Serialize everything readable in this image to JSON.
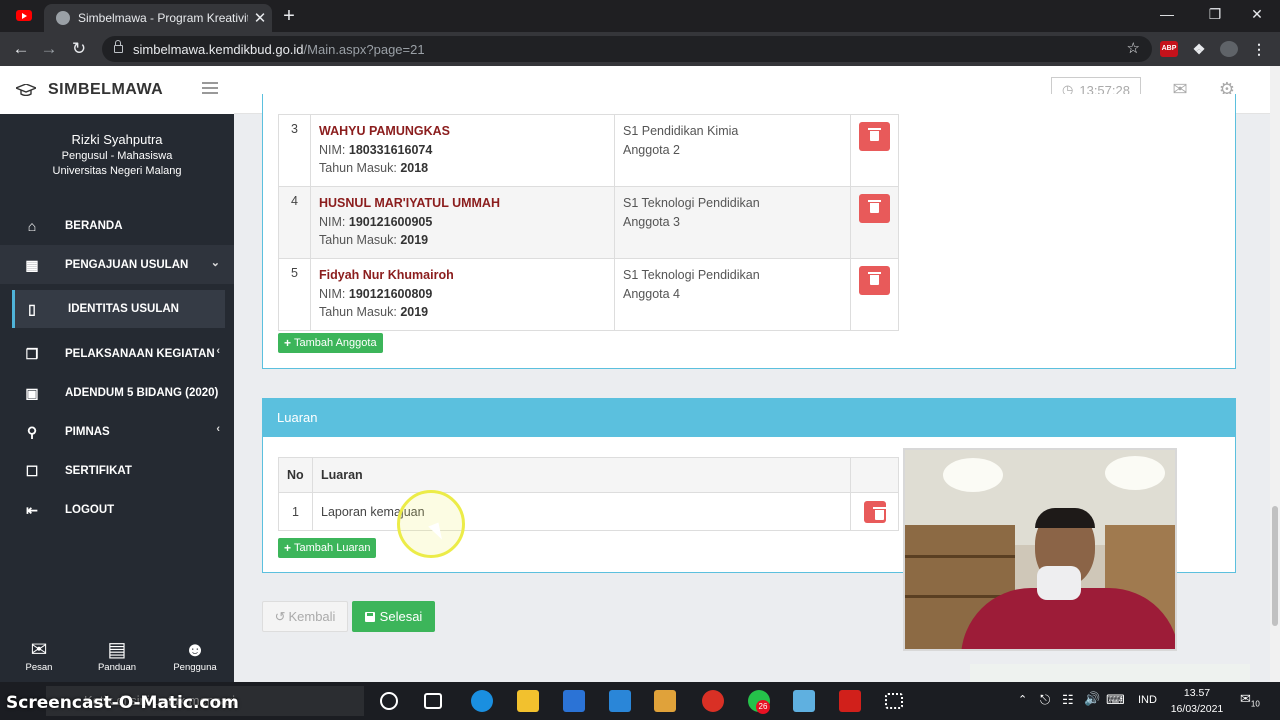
{
  "browser": {
    "tab_title": "Simbelmawa - Program Kreativita",
    "tab_close": "✕",
    "new_tab": "+",
    "url_host": "simbelmawa.kemdikbud.go.id",
    "url_path": "/Main.aspx?page=21",
    "ext_abp": "ABP"
  },
  "sidebar": {
    "brand": "SIMBELMAWA",
    "user_name": "Rizki Syahputra",
    "user_role": "Pengusul - Mahasiswa",
    "user_univ": "Universitas Negeri Malang",
    "menu": [
      {
        "label": "BERANDA",
        "icon": "home-icon"
      },
      {
        "label": "PENGAJUAN USULAN",
        "icon": "book-open-icon"
      },
      {
        "label": "IDENTITAS USULAN",
        "icon": "book-icon"
      },
      {
        "label": "PELAKSANAAN KEGIATAN",
        "icon": "copy-icon"
      },
      {
        "label": "ADENDUM 5 BIDANG (2020)",
        "icon": "briefcase-icon"
      },
      {
        "label": "PIMNAS",
        "icon": "trophy-icon"
      },
      {
        "label": "SERTIFIKAT",
        "icon": "file-icon"
      },
      {
        "label": "LOGOUT",
        "icon": "sign-out-icon"
      }
    ],
    "bottom": [
      {
        "label": "Pesan",
        "icon": "envelope-icon"
      },
      {
        "label": "Panduan",
        "icon": "notebook-icon"
      },
      {
        "label": "Pengguna",
        "icon": "user-icon"
      }
    ]
  },
  "topbar": {
    "time": "13:57:28"
  },
  "members": [
    {
      "no": "3",
      "name": "WAHYU PAMUNGKAS",
      "nim_label": "NIM:",
      "nim": "180331616074",
      "year_label": "Tahun Masuk:",
      "year": "2018",
      "program": "S1 Pendidikan Kimia",
      "role": "Anggota 2"
    },
    {
      "no": "4",
      "name": "HUSNUL MAR'IYATUL UMMAH",
      "nim_label": "NIM:",
      "nim": "190121600905",
      "year_label": "Tahun Masuk:",
      "year": "2019",
      "program": "S1 Teknologi Pendidikan",
      "role": "Anggota 3"
    },
    {
      "no": "5",
      "name": "Fidyah Nur Khumairoh",
      "nim_label": "NIM:",
      "nim": "190121600809",
      "year_label": "Tahun Masuk:",
      "year": "2019",
      "program": "S1 Teknologi Pendidikan",
      "role": "Anggota 4"
    }
  ],
  "add_member_label": "Tambah Anggota",
  "luaran": {
    "title": "Luaran",
    "col_no": "No",
    "col_luaran": "Luaran",
    "rows": [
      {
        "no": "1",
        "text": "Laporan kemajuan"
      }
    ],
    "add_label": "Tambah Luaran"
  },
  "actions": {
    "back": "Kembali",
    "done": "Selesai"
  },
  "taskbar": {
    "watermark": "Screencast-O-Matic.com",
    "search_placeholder": "Ketik di sini untuk mencari",
    "lang": "IND",
    "time": "13.57",
    "date": "16/03/2021",
    "whatsapp_badge": "26",
    "notif_count": "10"
  },
  "colors": {
    "accent": "#5bc0de",
    "success": "#3cb55a",
    "danger": "#e85a5a",
    "sidebar": "#252a32"
  }
}
